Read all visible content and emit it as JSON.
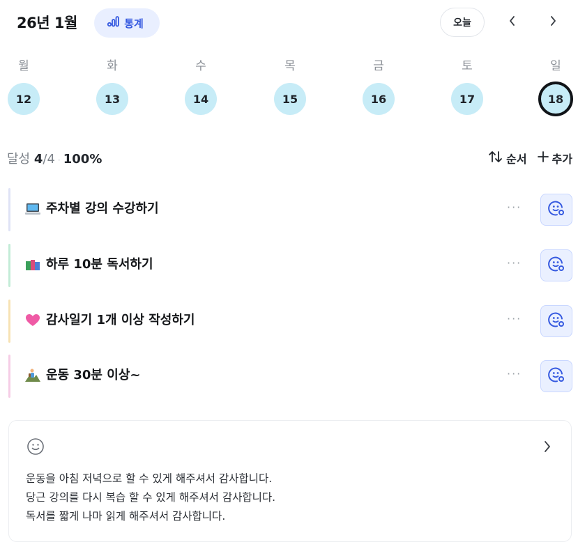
{
  "header": {
    "title": "26년 1월",
    "stats_label": "통계",
    "today_label": "오늘",
    "prev_icon": "chevron-left-icon",
    "next_icon": "chevron-right-icon"
  },
  "week": {
    "weekdays": [
      "월",
      "화",
      "수",
      "목",
      "금",
      "토",
      "일"
    ],
    "days": [
      "12",
      "13",
      "14",
      "15",
      "16",
      "17",
      "18"
    ],
    "selected_day": "18"
  },
  "summary": {
    "label": "달성",
    "done": "4",
    "total": "/4",
    "separator": "·",
    "percent": "100%",
    "sort_label": "순서",
    "add_label": "추가"
  },
  "tasks": [
    {
      "icon": "laptop-emoji-icon",
      "text": "주차별 강의 수강하기",
      "color": "#dfe3f6"
    },
    {
      "icon": "books-emoji-icon",
      "text": "하루 10분 독서하기",
      "color": "#c3ecd7"
    },
    {
      "icon": "heart-emoji-icon",
      "text": "감사일기 1개 이상 작성하기",
      "color": "#f7e2b4"
    },
    {
      "icon": "hiker-emoji-icon",
      "text": "운동 30분 이상~",
      "color": "#f6cde6"
    }
  ],
  "more_label": "···",
  "gratitude": {
    "lines": [
      "운동을 아침 저녁으로 할 수 있게 해주셔서 감사합니다.",
      "당근 강의를 다시 복습 할 수 있게 해주셔서 감사합니다.",
      "독서를 짧게 나마 읽게 해주셔서 감사합니다."
    ]
  },
  "colors": {
    "accent": "#3559e0",
    "day_bg": "#c7ecf7",
    "stats_bg": "#e9efff"
  }
}
